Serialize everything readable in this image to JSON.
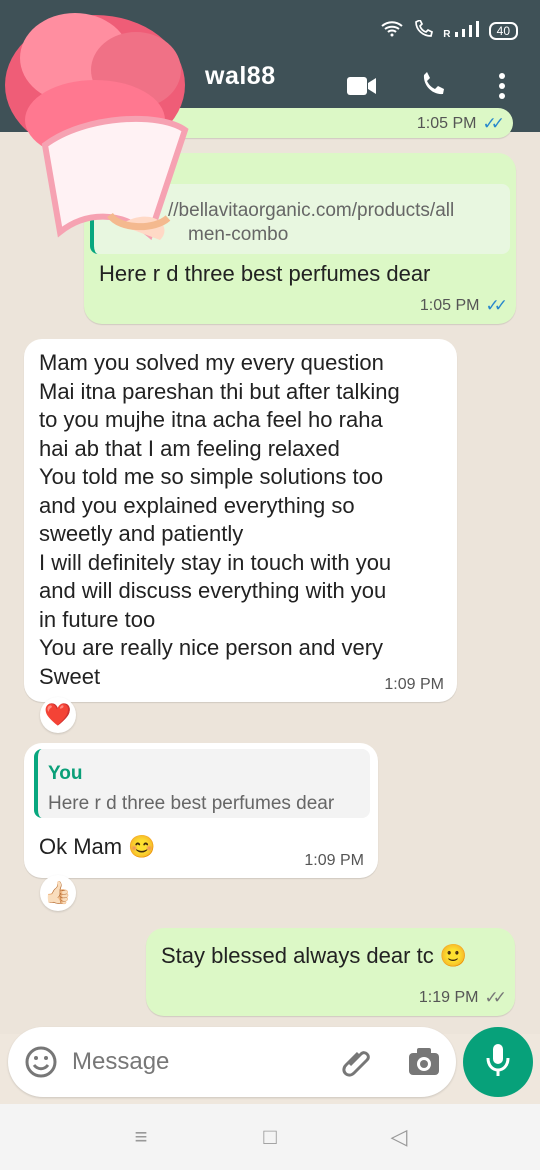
{
  "statusbar": {
    "signal_text": "R",
    "battery_level": "40"
  },
  "header": {
    "contact_name_partial": "wal88"
  },
  "messages": [
    {
      "type": "outgoing_link",
      "link_line1": "//bellavitaorganic.com/products/all",
      "link_line2": "men-combo",
      "text": "Here r d three best perfumes dear",
      "time": "1:05 PM"
    },
    {
      "type": "incoming",
      "lines": [
        "Mam you solved my every question",
        "Mai itna pareshan thi but after talking",
        "to you mujhe itna acha feel ho raha",
        "hai ab that I am feeling relaxed",
        "You told me so simple solutions too",
        "and you explained everything so",
        "sweetly and patiently",
        "I will definitely stay in touch with you",
        "and will discuss everything with you",
        "in future too",
        "You are really nice person and very",
        "Sweet"
      ],
      "time": "1:09 PM",
      "reaction": "❤️"
    },
    {
      "type": "incoming_reply",
      "quote_name": "You",
      "quote_text": "Here r d three best perfumes dear",
      "text": "Ok Mam 😊",
      "time": "1:09 PM",
      "reaction": "👍🏻"
    },
    {
      "type": "outgoing",
      "text": "Stay blessed always dear tc 🙂",
      "time": "1:19 PM"
    }
  ],
  "composer": {
    "placeholder": "Message"
  },
  "partial_top_time": "1:05 PM",
  "colors": {
    "header": "#3f5157",
    "outgoing_bubble": "#dcf8c6",
    "incoming_bubble": "#ffffff",
    "accent": "#07a17a",
    "read_ticks": "#2787cc"
  },
  "icons": {
    "wifi": "wifi-icon",
    "call_status": "call-status-icon",
    "signal": "signal-icon",
    "video": "video-call-icon",
    "call": "phone-icon",
    "menu": "more-vert-icon",
    "emoji": "emoji-icon",
    "attach": "paperclip-icon",
    "camera": "camera-icon",
    "mic": "mic-icon"
  }
}
